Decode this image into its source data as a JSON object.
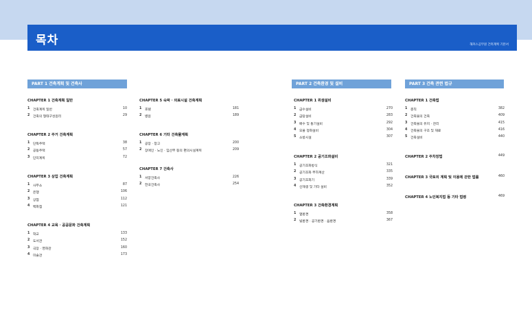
{
  "header": {
    "title": "목차",
    "subtitle": "해커스공무원 건축계획 기본서"
  },
  "parts": [
    {
      "label": "PART 1 건축계획 및 건축사"
    },
    {
      "label": "PART 2 건축환경 및 설비"
    },
    {
      "label": "PART 3 건축 관련 법규"
    }
  ],
  "chapters": [
    {
      "title": "CHAPTER 1 건축계획 일반",
      "entries": [
        {
          "num": "1",
          "title": "건축계획 일반",
          "page": "10"
        },
        {
          "num": "2",
          "title": "건축의 형태구성원리",
          "page": "29"
        }
      ]
    },
    {
      "title": "CHAPTER 2 주거 건축계획",
      "entries": [
        {
          "num": "1",
          "title": "단독주택",
          "page": "38"
        },
        {
          "num": "2",
          "title": "공동주택",
          "page": "57"
        },
        {
          "num": "3",
          "title": "단지계획",
          "page": "72"
        }
      ]
    },
    {
      "title": "CHAPTER 3 상업 건축계획",
      "entries": [
        {
          "num": "1",
          "title": "사무소",
          "page": "87"
        },
        {
          "num": "2",
          "title": "은행",
          "page": "106"
        },
        {
          "num": "3",
          "title": "상점",
          "page": "112"
        },
        {
          "num": "4",
          "title": "백화점",
          "page": "121"
        }
      ]
    },
    {
      "title": "CHAPTER 4 교육 · 공공문화 건축계획",
      "entries": [
        {
          "num": "1",
          "title": "학교",
          "page": "133"
        },
        {
          "num": "2",
          "title": "도서관",
          "page": "152"
        },
        {
          "num": "3",
          "title": "극장 · 영화관",
          "page": "160"
        },
        {
          "num": "4",
          "title": "미술관",
          "page": "173"
        }
      ]
    },
    {
      "title": "CHAPTER 5 숙박 · 의료시설 건축계획",
      "entries": [
        {
          "num": "1",
          "title": "호텔",
          "page": "181"
        },
        {
          "num": "2",
          "title": "병원",
          "page": "189"
        }
      ]
    },
    {
      "title": "CHAPTER 6 기타 건축물계획",
      "entries": [
        {
          "num": "1",
          "title": "공장 · 창고",
          "page": "200"
        },
        {
          "num": "2",
          "title": "장애인 · 노인 · 임산부 등의 편의시설계획",
          "page": "209"
        }
      ]
    },
    {
      "title": "CHAPTER 7 건축사",
      "entries": [
        {
          "num": "1",
          "title": "서양건축사",
          "page": "226"
        },
        {
          "num": "2",
          "title": "한국건축사",
          "page": "254"
        }
      ]
    },
    {
      "title": "CHAPTER 1 위생설비",
      "entries": [
        {
          "num": "1",
          "title": "급수설비",
          "page": "270"
        },
        {
          "num": "2",
          "title": "급탕설비",
          "page": "283"
        },
        {
          "num": "3",
          "title": "배수 및 통기설비",
          "page": "292"
        },
        {
          "num": "4",
          "title": "오물 정화설비",
          "page": "304"
        },
        {
          "num": "5",
          "title": "소방시설",
          "page": "307"
        }
      ]
    },
    {
      "title": "CHAPTER 2 공기조화설비",
      "entries": [
        {
          "num": "1",
          "title": "공기조화방식",
          "page": "321"
        },
        {
          "num": "2",
          "title": "공기조화 부하계산",
          "page": "335"
        },
        {
          "num": "3",
          "title": "공기조화기",
          "page": "339"
        },
        {
          "num": "4",
          "title": "신재생 및 기타 설비",
          "page": "352"
        }
      ]
    },
    {
      "title": "CHAPTER 3 건축환경계획",
      "entries": [
        {
          "num": "1",
          "title": "열환경",
          "page": "358"
        },
        {
          "num": "2",
          "title": "빛환경 · 공기환경 · 음환경",
          "page": "367"
        }
      ]
    },
    {
      "title": "CHAPTER 1 건축법",
      "entries": [
        {
          "num": "1",
          "title": "총칙",
          "page": "382"
        },
        {
          "num": "2",
          "title": "건축물의 건축",
          "page": "409"
        },
        {
          "num": "3",
          "title": "건축물의 유지 · 관리",
          "page": "415"
        },
        {
          "num": "4",
          "title": "건축물의 구조 및 재료",
          "page": "416"
        },
        {
          "num": "5",
          "title": "건축설비",
          "page": "440"
        }
      ]
    }
  ],
  "solo_chapters": [
    {
      "title": "CHAPTER 2 주차장법",
      "page": "449"
    },
    {
      "title": "CHAPTER 3 국토의 계획 및 이용에 관한 법률",
      "page": "460"
    },
    {
      "title": "CHAPTER 4 노인복지법 등 기타 법령",
      "page": "469"
    }
  ]
}
